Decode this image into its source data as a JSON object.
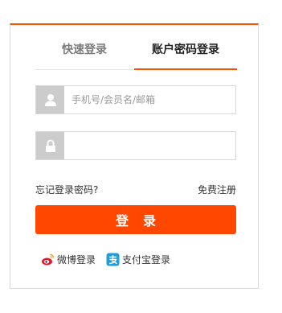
{
  "tabs": {
    "quick_login": "快速登录",
    "account_login": "账户密码登录",
    "active": "account_login"
  },
  "form": {
    "username_placeholder": "手机号/会员名/邮箱",
    "username_value": "",
    "password_placeholder": "",
    "password_value": "",
    "forgot_password": "忘记登录密码?",
    "register": "免费注册",
    "login_button": "登录"
  },
  "social": {
    "weibo": "微博登录",
    "alipay": "支付宝登录"
  },
  "colors": {
    "accent": "#ff5000",
    "button": "#ff4700",
    "icon_box": "#cccccc"
  },
  "icons": {
    "username": "user-icon",
    "password": "lock-icon",
    "weibo": "weibo-icon",
    "alipay": "alipay-icon"
  }
}
